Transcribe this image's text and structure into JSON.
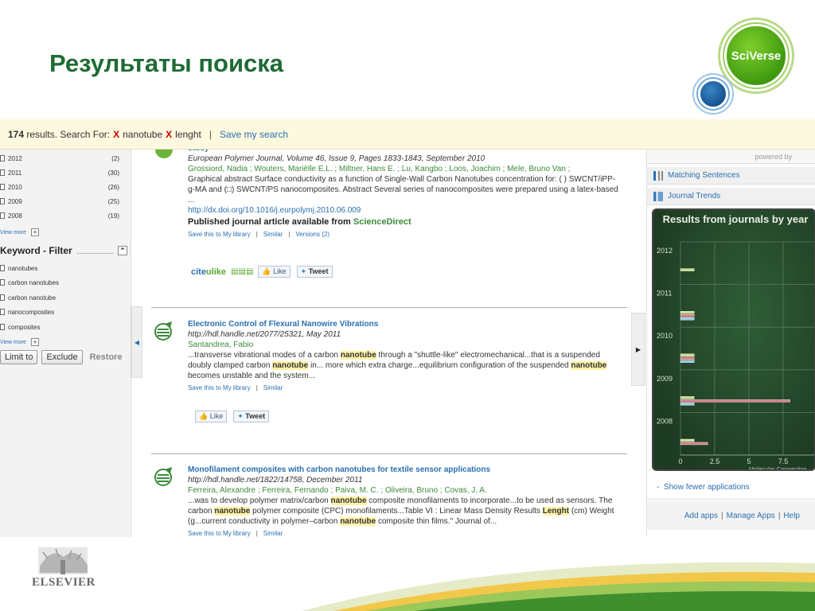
{
  "slide": {
    "title": "Результаты поиска",
    "sciverse_label": "SciVerse",
    "elsevier_label": "ELSEVIER"
  },
  "search_bar": {
    "count": "174",
    "results_text": "results. Search For:",
    "terms": [
      "nanotube",
      "lenght"
    ],
    "remove_glyph": "X",
    "separator": "|",
    "save_label": "Save my search"
  },
  "left_panel": {
    "years": [
      {
        "year": "2012",
        "count": "(2)"
      },
      {
        "year": "2011",
        "count": "(30)"
      },
      {
        "year": "2010",
        "count": "(26)"
      },
      {
        "year": "2009",
        "count": "(25)"
      },
      {
        "year": "2008",
        "count": "(19)"
      }
    ],
    "view_more": "View more",
    "keyword_filter_label": "Keyword - Filter",
    "keywords": [
      "nanotubes",
      "carbon nanotubes",
      "carbon nanotube",
      "nanocomposites",
      "composites"
    ],
    "limit_to": "Limit to",
    "exclude": "Exclude",
    "restore": "Restore"
  },
  "results": [
    {
      "title": "study",
      "source": "European Polymer Journal, Volume 46, Issue 9, Pages 1833-1843, September 2010",
      "authors": "Grossiord, Nadia ; Wouters, Mariëlle E.L. ; Miltner, Hans E. ; Lu, Kangbo ; Loos, Joachim ; Mele, Bruno Van ;",
      "abstract": "Graphical abstract Surface conductivity as a function of Single-Wall Carbon Nanotubes concentration for: ( ) SWCNT/iPP-g-MA and (□) SWCNT/PS nanocomposites. Abstract Several series of nanocomposites were prepared using a latex-based ...",
      "url": "http://dx.doi.org/10.1016/j.eurpolymj.2010.06.009",
      "published_text": "Published journal article available from",
      "published_source": "ScienceDirect",
      "links": [
        "Save this to My library",
        "Similar",
        "Versions (2)"
      ]
    },
    {
      "title": "Electronic Control of Flexural Nanowire Vibrations",
      "source": "http://hdl.handle.net/2077/25321, May 2011",
      "authors": "Santandrea, Fabio",
      "abstract_parts": [
        {
          "t": "...transverse vibrational modes of a carbon "
        },
        {
          "t": "nanotube",
          "hl": true
        },
        {
          "t": " through a \"shuttle-like\" electromechanical...that is a suspended doubly clamped carbon "
        },
        {
          "t": "nanotube",
          "hl": true
        },
        {
          "t": " in... more which extra charge...equilibrium configuration of the suspended "
        },
        {
          "t": "nanotube",
          "hl": true
        },
        {
          "t": " becomes unstable and the system..."
        }
      ],
      "links": [
        "Save this to My library",
        "Similar"
      ]
    },
    {
      "title": "Monofilament composites with carbon nanotubes for textile sensor applications",
      "source": "http://hdl.handle.net/1822/14758, December 2011",
      "authors": "Ferreira, Alexandre ; Ferreira, Fernando ; Paiva, M. C. ; Oliveira, Bruno ; Covas, J. A.",
      "abstract_parts": [
        {
          "t": "...was to develop polymer matrix/carbon "
        },
        {
          "t": "nanotube",
          "hl": true
        },
        {
          "t": " composite monofilaments to incorporate...to be used as sensors. The carbon "
        },
        {
          "t": "nanotube",
          "hl": true
        },
        {
          "t": " polymer composite (CPC) monofilaments...Table VI : Linear Mass Density Results "
        },
        {
          "t": "Lenght",
          "hl": true
        },
        {
          "t": " (cm) Weight (g...current conductivity in polymer–carbon "
        },
        {
          "t": "nanotube",
          "hl": true
        },
        {
          "t": " composite thin films.\" Journal of..."
        }
      ],
      "links": [
        "Save this to My library",
        "Similar"
      ]
    }
  ],
  "social": {
    "citeulike_a": "cite",
    "citeulike_b": "ulike",
    "like": "Like",
    "tweet": "Tweet"
  },
  "right_panel": {
    "powered_by": "powered by",
    "matching_sentences": "Matching Sentences",
    "journal_trends": "Journal Trends",
    "show_fewer": "Show fewer applications",
    "dash": "-",
    "add_apps": "Add apps",
    "manage_apps": "Manage Apps",
    "help": "Help"
  },
  "colors": {
    "title_green": "#1f6b35",
    "link_blue": "#2a6fb0",
    "highlight": "#fff2a6",
    "chart_bg": "#254a2b"
  },
  "chart_data": {
    "type": "bar",
    "orientation": "horizontal",
    "title": "Results from journals by year",
    "xlabel": "Molecular Connection",
    "categories": [
      "2012",
      "2011",
      "2010",
      "2009",
      "2008"
    ],
    "xticks": [
      "0",
      "2.5",
      "5",
      "7.5"
    ],
    "xlim": [
      0,
      10
    ],
    "grid": true,
    "series": [
      {
        "values": [
          1,
          1,
          1,
          1,
          1
        ],
        "color": "#c8e08a"
      },
      {
        "values": [
          0,
          1,
          1,
          8,
          2
        ],
        "color": "#d87b8a"
      },
      {
        "values": [
          0,
          1,
          1,
          1,
          0
        ],
        "color": "#9ecbe0"
      }
    ]
  }
}
